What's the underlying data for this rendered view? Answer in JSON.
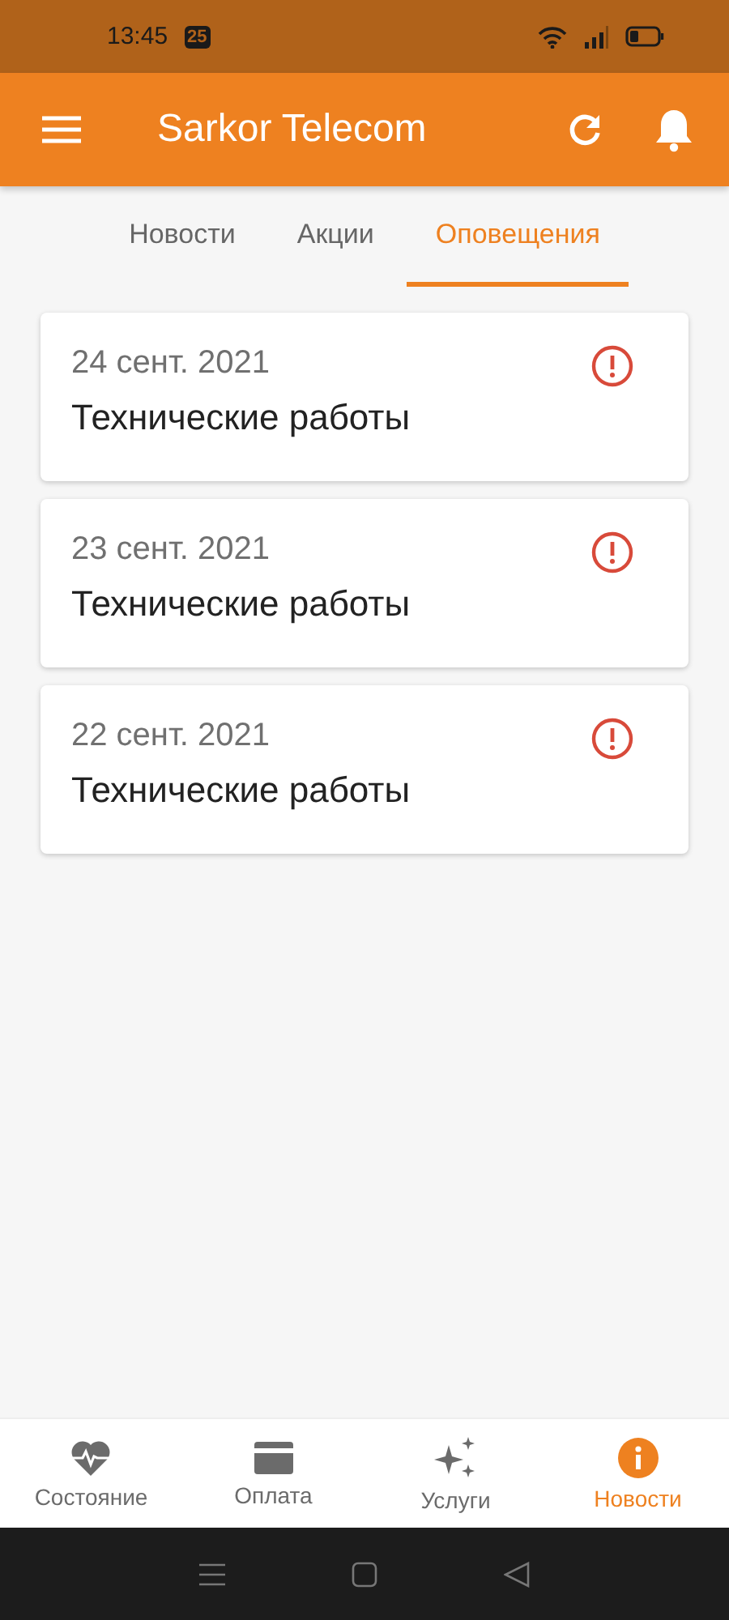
{
  "status_bar": {
    "time": "13:45",
    "badge": "25"
  },
  "app_bar": {
    "title": "Sarkor Telecom"
  },
  "tabs": [
    {
      "label": "Новости",
      "selected": false
    },
    {
      "label": "Акции",
      "selected": false
    },
    {
      "label": "Оповещения",
      "selected": true
    }
  ],
  "alerts": [
    {
      "date": "24 сент. 2021",
      "title": "Технические работы"
    },
    {
      "date": "23 сент. 2021",
      "title": "Технические работы"
    },
    {
      "date": "22 сент. 2021",
      "title": "Технические работы"
    }
  ],
  "bottom_nav": [
    {
      "kind": "status",
      "label": "Состояние",
      "selected": false
    },
    {
      "kind": "payment",
      "label": "Оплата",
      "selected": false
    },
    {
      "kind": "services",
      "label": "Услуги",
      "selected": false
    },
    {
      "kind": "news",
      "label": "Новости",
      "selected": true
    }
  ]
}
